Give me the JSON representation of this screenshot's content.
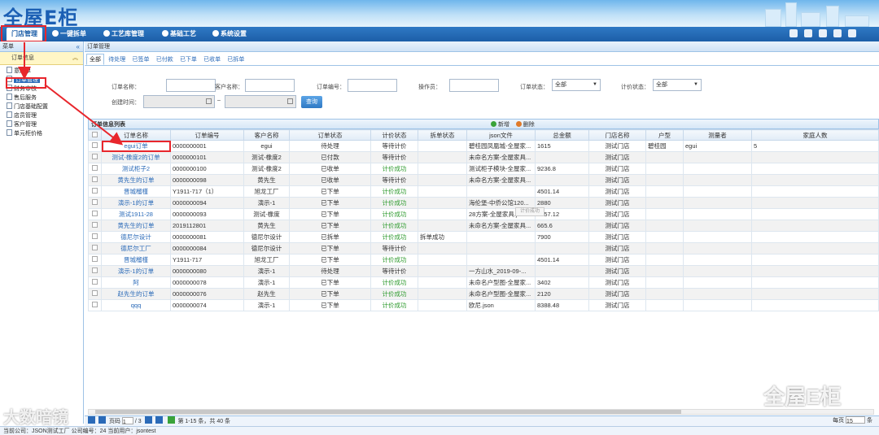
{
  "header": {
    "logo": "全屋E柜"
  },
  "nav": [
    {
      "label": "门店管理"
    },
    {
      "label": "一键拆单"
    },
    {
      "label": "工艺库管理"
    },
    {
      "label": "基础工艺"
    },
    {
      "label": "系统设置"
    }
  ],
  "sidebar": {
    "title": "菜单",
    "group": "订单信息",
    "items": [
      {
        "label": "意向单"
      },
      {
        "label": "订单管理"
      },
      {
        "label": "财务审核"
      },
      {
        "label": "售后服务"
      },
      {
        "label": "门店基础配置"
      },
      {
        "label": "店员管理"
      },
      {
        "label": "客户管理"
      },
      {
        "label": "单元柜价格"
      }
    ]
  },
  "breadcrumb": "订单管理",
  "tabs": [
    "全部",
    "待处理",
    "已签单",
    "已付款",
    "已下单",
    "已收单",
    "已拆单"
  ],
  "form": {
    "order_name": "订单名称：",
    "customer_name": "客户名称：",
    "order_no": "订单编号：",
    "operator": "操作员：",
    "order_status": "订单状态：",
    "order_status_value": "全部",
    "price_status": "计价状态：",
    "price_status_value": "全部",
    "created": "创建时间：",
    "dash": "–",
    "query": "查询"
  },
  "grid": {
    "title": "订单信息列表",
    "add": "新增",
    "delete": "删除",
    "loading": "计价成功",
    "columns": [
      "订单名称",
      "订单编号",
      "客户名称",
      "订单状态",
      "计价状态",
      "拆单状态",
      "json文件",
      "总金额",
      "门店名称",
      "户型",
      "测量者",
      "家庭人数"
    ],
    "rows": [
      [
        "egui订单",
        "0000000001",
        "egui",
        "待处理",
        "等待计价",
        "",
        "碧桂园凤凰城-全屋家...",
        "1615",
        "测试门店",
        "碧桂园",
        "egui",
        "5"
      ],
      [
        "测试-橡度2的订单",
        "0000000101",
        "测试-橡度2",
        "已付款",
        "等待计价",
        "",
        "未命名方案-全屋家具...",
        "",
        "测试门店",
        "",
        "",
        ""
      ],
      [
        "测试柜子2",
        "0000000100",
        "测试-橡度2",
        "已收单",
        "计价成功",
        "",
        "测试柜子模块-全屋家...",
        "9236.8",
        "测试门店",
        "",
        "",
        ""
      ],
      [
        "黄先生的订单",
        "0000000098",
        "黄先生",
        "已收单",
        "等待计价",
        "",
        "未命名方案-全屋家具...",
        "",
        "测试门店",
        "",
        "",
        ""
      ],
      [
        "晋城榴槿",
        "Y1911-717（1）",
        "旭龙工厂",
        "已下单",
        "计价成功",
        "",
        "",
        "4501.14",
        "测试门店",
        "",
        "",
        ""
      ],
      [
        "演示-1的订单",
        "0000000094",
        "演示-1",
        "已下单",
        "计价成功",
        "",
        "海伦堡-中侨公馆120...",
        "2880",
        "测试门店",
        "",
        "",
        ""
      ],
      [
        "测试1911-28",
        "0000000093",
        "测试-橡度",
        "已下单",
        "计价成功",
        "",
        "28方案-全屋家具.json",
        "2757.12",
        "测试门店",
        "",
        "",
        ""
      ],
      [
        "黄先生的订单",
        "2019112801",
        "黄先生",
        "已下单",
        "计价成功",
        "",
        "未命名方案-全屋家具...",
        "665.6",
        "测试门店",
        "",
        "",
        ""
      ],
      [
        "德尼尔设计",
        "0000000081",
        "德尼尔设计",
        "已拆单",
        "计价成功",
        "拆单成功",
        "",
        "7900",
        "测试门店",
        "",
        "",
        ""
      ],
      [
        "德尼尔工厂",
        "0000000084",
        "德尼尔设计",
        "已下单",
        "等待计价",
        "",
        "",
        "",
        "测试门店",
        "",
        "",
        ""
      ],
      [
        "晋城榴槿",
        "Y1911-717",
        "旭龙工厂",
        "已下单",
        "计价成功",
        "",
        "",
        "4501.14",
        "测试门店",
        "",
        "",
        ""
      ],
      [
        "演示-1的订单",
        "0000000080",
        "演示-1",
        "待处理",
        "等待计价",
        "",
        "一方山水_2019-09-...",
        "",
        "测试门店",
        "",
        "",
        ""
      ],
      [
        "阿",
        "0000000078",
        "演示-1",
        "已下单",
        "计价成功",
        "",
        "未命名户型图-全屋家...",
        "3402",
        "测试门店",
        "",
        "",
        ""
      ],
      [
        "赵先生的订单",
        "0000000076",
        "赵先生",
        "已下单",
        "计价成功",
        "",
        "未命名户型图-全屋家...",
        "2120",
        "测试门店",
        "",
        "",
        ""
      ],
      [
        "qqq",
        "0000000074",
        "演示-1",
        "已下单",
        "计价成功",
        "",
        "欧尼.json",
        "8388.48",
        "测试门店",
        "",
        "",
        ""
      ]
    ]
  },
  "pager": {
    "page_label": "页码",
    "page": "1",
    "total_pages": "/ 3",
    "range": "第 1-15 条，共 40 条",
    "per_page_label": "每页",
    "per_page": "15",
    "unit": "条"
  },
  "status": "当前公司：JSON测试工厂   公司编号：24   当前用户：jsontest",
  "watermarks": {
    "left": "大数暗镜",
    "right": "全屋E柜"
  },
  "colors": {
    "nav": "#1c5ea8",
    "highlight": "#e8262c",
    "link": "#2a6ab8",
    "success": "#2d9a2d"
  }
}
